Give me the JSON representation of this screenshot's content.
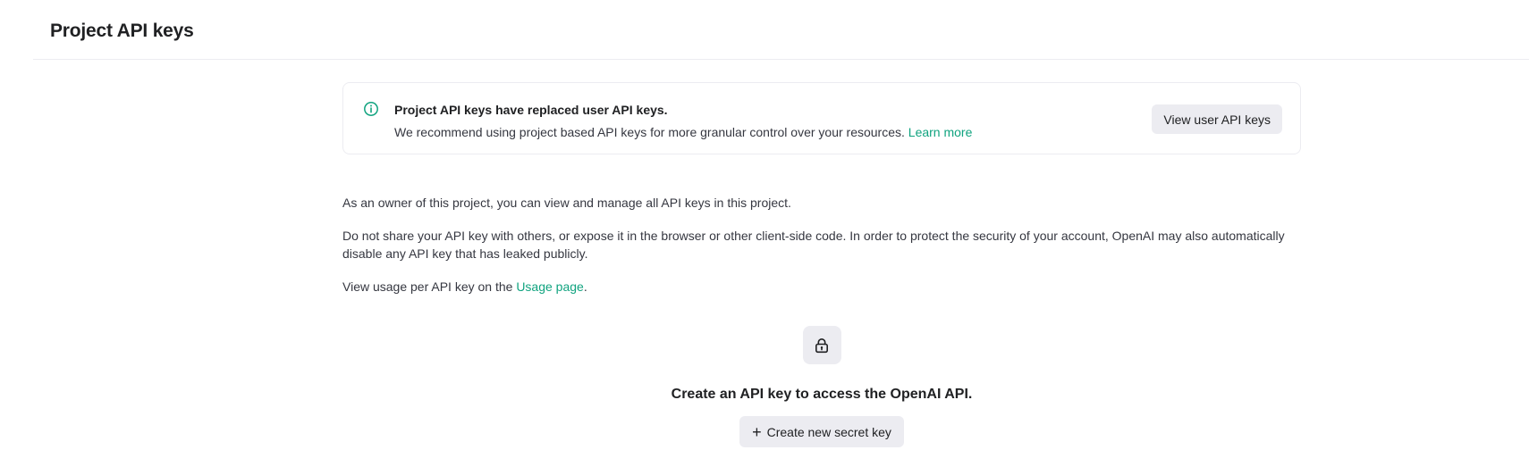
{
  "header": {
    "title": "Project API keys"
  },
  "notice": {
    "title": "Project API keys have replaced user API keys.",
    "body": "We recommend using project based API keys for more granular control over your resources.",
    "learn_more": "Learn more",
    "view_button": "View user API keys",
    "accent_color": "#10a37f",
    "icon": "info-icon"
  },
  "info": {
    "owner_text": "As an owner of this project, you can view and manage all API keys in this project.",
    "warning_text": "Do not share your API key with others, or expose it in the browser or other client-side code. In order to protect the security of your account, OpenAI may also automatically disable any API key that has leaked publicly.",
    "usage_prefix": "View usage per API key on the ",
    "usage_link": "Usage page",
    "usage_suffix": "."
  },
  "empty_state": {
    "icon": "lock-icon",
    "title": "Create an API key to access the OpenAI API.",
    "button_plus": "+",
    "button_label": "Create new secret key"
  }
}
